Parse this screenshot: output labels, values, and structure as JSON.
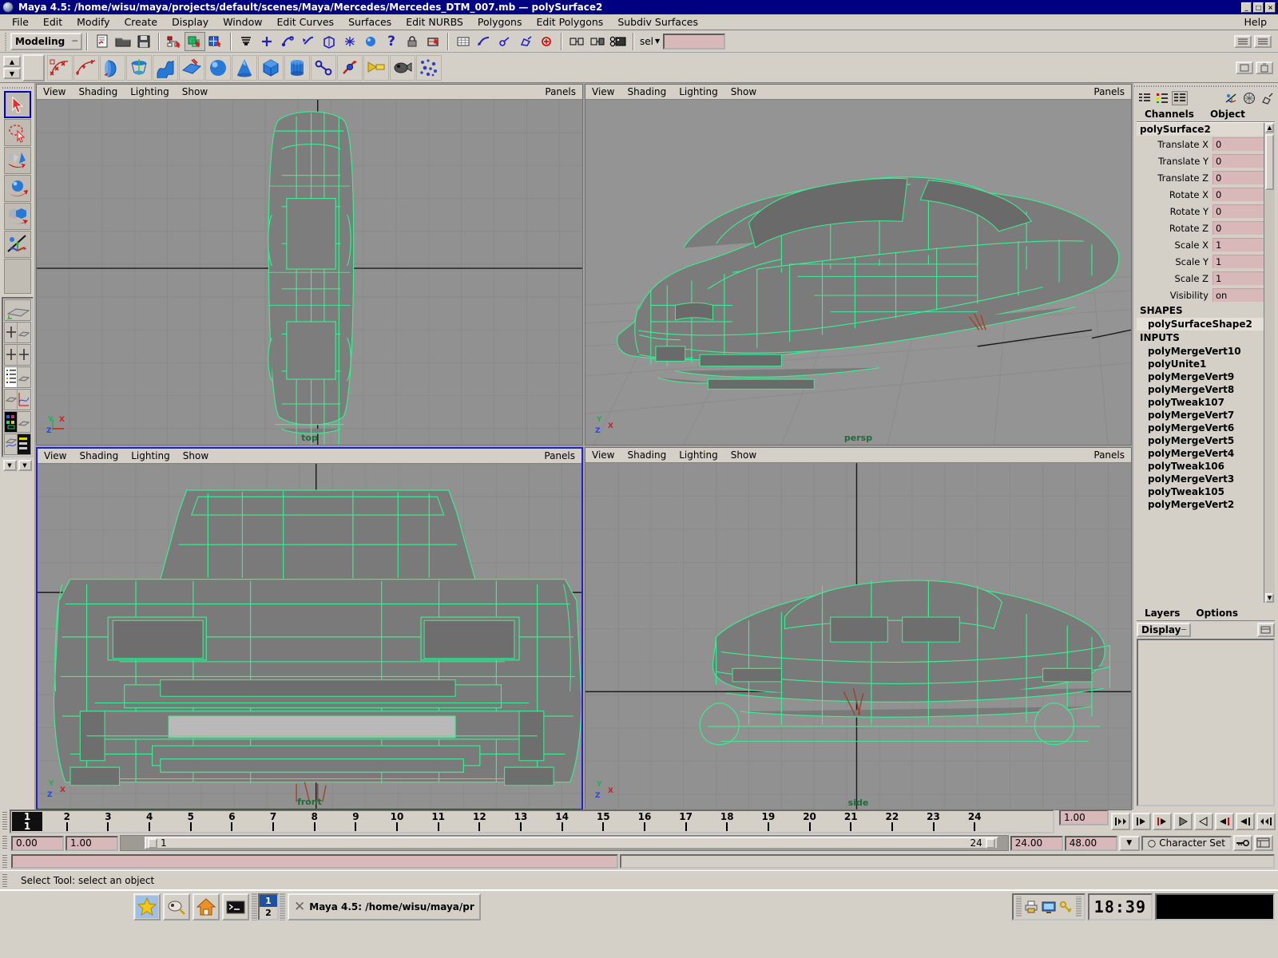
{
  "window": {
    "title": "Maya 4.5: /home/wisu/maya/projects/default/scenes/Maya/Mercedes/Mercedes_DTM_007.mb  —  polySurface2",
    "btn_minimize": "_",
    "btn_maximize": "□",
    "btn_close": "×"
  },
  "menubar": {
    "items": [
      "File",
      "Edit",
      "Modify",
      "Create",
      "Display",
      "Window",
      "Edit Curves",
      "Surfaces",
      "Edit NURBS",
      "Polygons",
      "Edit Polygons",
      "Subdiv Surfaces"
    ],
    "help": "Help"
  },
  "statusline": {
    "menu_set": "Modeling",
    "menu_set_arrow": "─",
    "selection_mode_label": "sel",
    "selection_field_value": "",
    "icons": [
      "new-scene-icon",
      "open-scene-icon",
      "save-scene-icon",
      "select-by-hierarchy-icon",
      "select-by-object-icon",
      "select-by-component-icon",
      "selection-mask-icon",
      "snap-to-grid-icon",
      "snap-to-curve-icon",
      "snap-to-point-icon",
      "snap-to-view-plane-icon",
      "construction-history-icon",
      "render-current-frame-icon",
      "ipr-render-icon",
      "render-globals-icon",
      "history-toggle-icon",
      "input-connections-icon",
      "output-connections-icon",
      "lock-selection-icon",
      "highlight-selection-icon"
    ]
  },
  "shelf": {
    "scroll_up": "▲",
    "scroll_down": "▼",
    "items": [
      "cv-curve-icon",
      "ep-curve-icon",
      "revolve-icon",
      "loft-icon",
      "extrude-icon",
      "planar-surface-icon",
      "nurbs-sphere-icon",
      "nurbs-cone-icon",
      "poly-cube-icon",
      "poly-cylinder-icon",
      "poly-plane-icon",
      "poly-split-icon",
      "sculpt-tool-icon",
      "paint-tool-icon",
      "particles-icon"
    ]
  },
  "toolbox": {
    "tools": [
      {
        "name": "select-tool",
        "selected": true
      },
      {
        "name": "lasso-select-tool",
        "selected": false
      },
      {
        "name": "move-tool",
        "selected": false
      },
      {
        "name": "rotate-tool",
        "selected": false
      },
      {
        "name": "scale-tool",
        "selected": false
      },
      {
        "name": "show-manipulator-tool",
        "selected": false
      }
    ],
    "layouts": [
      "single-perspective-layout",
      "four-view-layout",
      "outliner-persp-layout",
      "persp-graph-layout",
      "hypershade-persp-layout",
      "persp-graph-outliner-layout"
    ],
    "arrow_left": "▼",
    "arrow_right": "▼"
  },
  "viewports": [
    {
      "name": "top",
      "label": "top",
      "menus": [
        "View",
        "Shading",
        "Lighting",
        "Show"
      ],
      "panels_label": "Panels",
      "active": false,
      "axis": {
        "up": "Y",
        "right": "X",
        "down": "Z"
      }
    },
    {
      "name": "persp",
      "label": "persp",
      "menus": [
        "View",
        "Shading",
        "Lighting",
        "Show"
      ],
      "panels_label": "Panels",
      "active": false,
      "axis": {
        "up": "Y",
        "right": "X",
        "down": "Z"
      }
    },
    {
      "name": "front",
      "label": "front",
      "menus": [
        "View",
        "Shading",
        "Lighting",
        "Show"
      ],
      "panels_label": "Panels",
      "active": true,
      "axis": {
        "up": "Y",
        "right": "X",
        "down": "Z"
      }
    },
    {
      "name": "side",
      "label": "side",
      "menus": [
        "View",
        "Shading",
        "Lighting",
        "Show"
      ],
      "panels_label": "Panels",
      "active": false,
      "axis": {
        "up": "Y",
        "right": "X",
        "down": "Z"
      }
    }
  ],
  "channelbox": {
    "toolbar_icons": [
      "channel-box-icon",
      "attribute-editor-icon",
      "channel-layer-icon",
      "tool-settings-icon",
      "render-view-icon",
      "paint-icon"
    ],
    "tabs": [
      "Channels",
      "Object"
    ],
    "node_name": "polySurface2",
    "attributes": [
      {
        "label": "Translate X",
        "value": "0"
      },
      {
        "label": "Translate Y",
        "value": "0"
      },
      {
        "label": "Translate Z",
        "value": "0"
      },
      {
        "label": "Rotate X",
        "value": "0"
      },
      {
        "label": "Rotate Y",
        "value": "0"
      },
      {
        "label": "Rotate Z",
        "value": "0"
      },
      {
        "label": "Scale X",
        "value": "1"
      },
      {
        "label": "Scale Y",
        "value": "1"
      },
      {
        "label": "Scale Z",
        "value": "1"
      },
      {
        "label": "Visibility",
        "value": "on"
      }
    ],
    "shapes_header": "SHAPES",
    "shapes": [
      "polySurfaceShape2"
    ],
    "inputs_header": "INPUTS",
    "inputs": [
      "polyMergeVert10",
      "polyUnite1",
      "polyMergeVert9",
      "polyMergeVert8",
      "polyTweak107",
      "polyMergeVert7",
      "polyMergeVert6",
      "polyMergeVert5",
      "polyMergeVert4",
      "polyTweak106",
      "polyMergeVert3",
      "polyTweak105",
      "polyMergeVert2"
    ]
  },
  "layers": {
    "tabs": [
      "Layers",
      "Options"
    ],
    "display_button": "Display",
    "display_arrow": "─",
    "layer_items": []
  },
  "timeslider": {
    "current_frame_top": "1",
    "current_frame_bottom": "1",
    "ticks": [
      "2",
      "3",
      "4",
      "5",
      "6",
      "7",
      "8",
      "9",
      "10",
      "11",
      "12",
      "13",
      "14",
      "15",
      "16",
      "17",
      "18",
      "19",
      "20",
      "21",
      "22",
      "23",
      "24"
    ],
    "current_time_value": "1.00",
    "playback_buttons": [
      "go-to-start-icon",
      "step-back-keyframe-icon",
      "step-back-frame-icon",
      "play-backwards-icon",
      "play-forwards-icon",
      "step-forward-frame-icon",
      "step-forward-keyframe-icon",
      "go-to-end-icon"
    ],
    "scroll_left": "<<",
    "scroll_right": ">>"
  },
  "rangeslider": {
    "anim_start": "0.00",
    "range_start": "1.00",
    "range_bar_start": "1",
    "range_bar_end": "24",
    "range_end": "24.00",
    "anim_end": "48.00",
    "dropdown_arrow": "▼",
    "character_set": "Character Set",
    "character_set_prefix": "○",
    "key_icon": "auto-key-icon",
    "anim_prefs_icon": "animation-preferences-icon"
  },
  "command": {
    "input_value": "",
    "output_value": ""
  },
  "feedback": {
    "message": "Select Tool: select an object"
  },
  "taskbar": {
    "apps": [
      "star-launcher-icon",
      "netscape-icon",
      "home-folder-icon",
      "terminal-icon"
    ],
    "pager_top": "1",
    "pager_bottom": "2",
    "window_button": "Maya 4.5: /home/wisu/maya/pr",
    "window_icon": "x-window-icon",
    "tray_icons": [
      "printer-icon",
      "display-icon",
      "key-icon"
    ],
    "clock": "18:39"
  },
  "colors": {
    "title_bar": "#000080",
    "face": "#d4d0c8",
    "pink_field": "#d8b8b8",
    "wireframe_green": "#3aef92",
    "viewport_bg": "#919191",
    "label_green": "#1d6b3a",
    "active_border": "#2020d0"
  }
}
